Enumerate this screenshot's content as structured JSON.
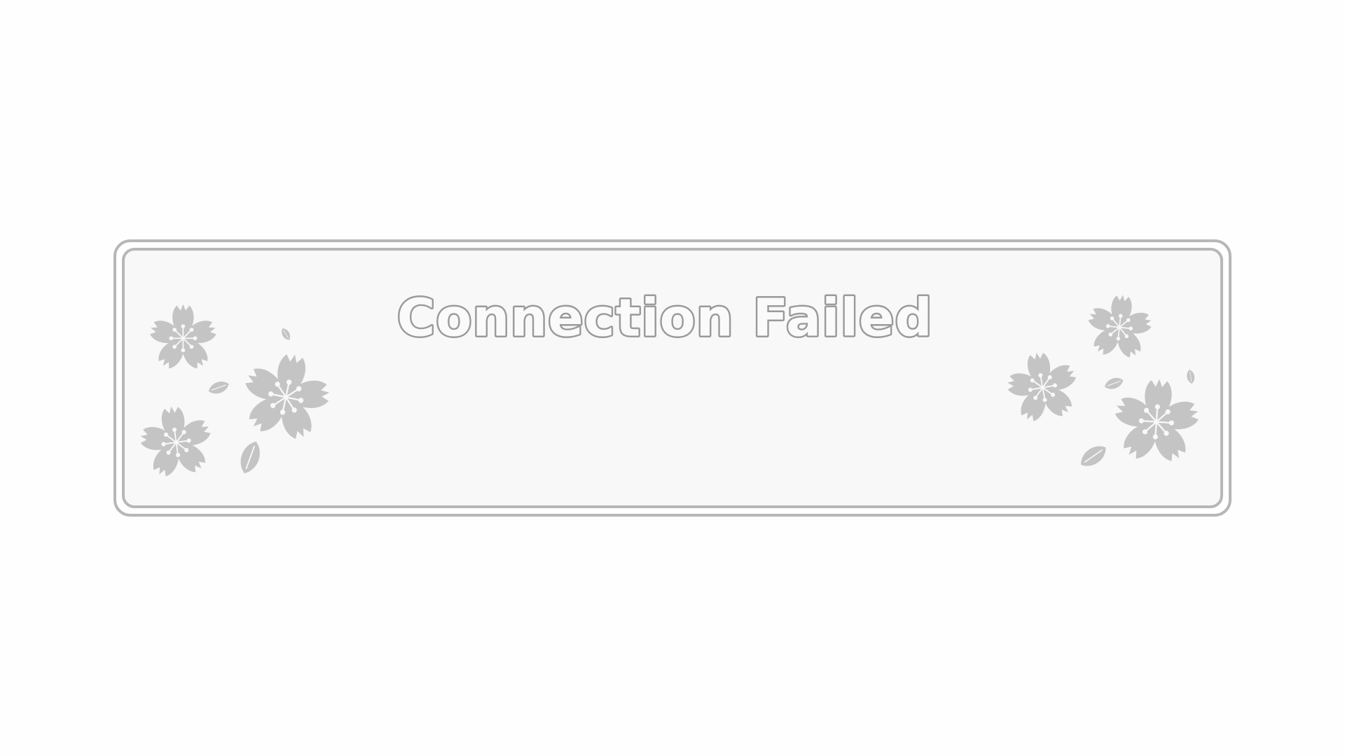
{
  "dialog": {
    "title": "Connection Failed"
  },
  "decor": {
    "icon": "cherry-blossom-icon",
    "color": "#c4c4c4",
    "frame_color": "#b7b7b7",
    "background_color": "#f8f8f8"
  }
}
